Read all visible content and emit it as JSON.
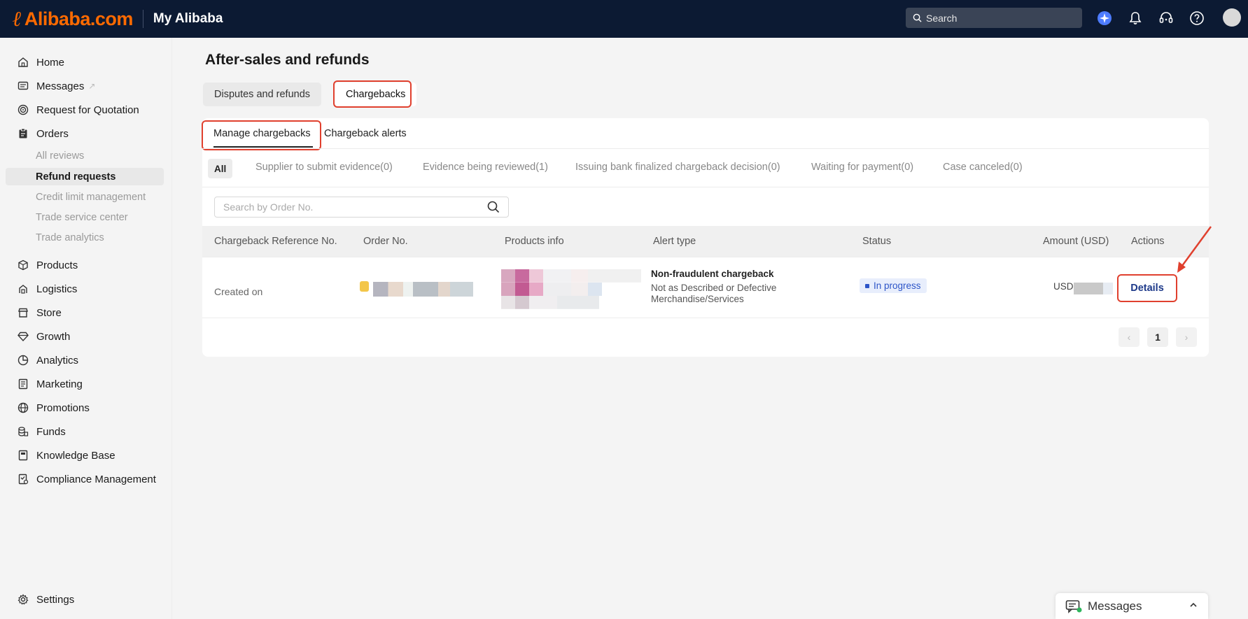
{
  "header": {
    "logo_text": "Alibaba.com",
    "brand_sub": "My Alibaba",
    "search_placeholder": "Search"
  },
  "sidebar": {
    "items": [
      {
        "label": "Home",
        "icon": "home-icon"
      },
      {
        "label": "Messages",
        "icon": "message-icon",
        "external": "↗"
      },
      {
        "label": "Request for Quotation",
        "icon": "target-icon"
      },
      {
        "label": "Orders",
        "icon": "clipboard-icon"
      },
      {
        "label": "Products",
        "icon": "cube-icon"
      },
      {
        "label": "Logistics",
        "icon": "truck-icon"
      },
      {
        "label": "Store",
        "icon": "store-icon"
      },
      {
        "label": "Growth",
        "icon": "diamond-icon"
      },
      {
        "label": "Analytics",
        "icon": "pie-icon"
      },
      {
        "label": "Marketing",
        "icon": "document-icon"
      },
      {
        "label": "Promotions",
        "icon": "globe-icon"
      },
      {
        "label": "Funds",
        "icon": "coins-icon"
      },
      {
        "label": "Knowledge Base",
        "icon": "book-icon"
      },
      {
        "label": "Compliance Management",
        "icon": "checklist-icon"
      }
    ],
    "orders_sub": [
      {
        "label": "All reviews"
      },
      {
        "label": "Refund requests"
      },
      {
        "label": "Credit limit management"
      },
      {
        "label": "Trade service center"
      },
      {
        "label": "Trade analytics"
      }
    ],
    "settings_label": "Settings"
  },
  "page": {
    "title": "After-sales and refunds",
    "tabs": [
      "Disputes and refunds",
      "Chargebacks"
    ],
    "sub_tabs": [
      "Manage chargebacks",
      "Chargeback alerts"
    ],
    "filters": [
      "All",
      "Supplier to submit evidence(0)",
      "Evidence being reviewed(1)",
      "Issuing bank finalized chargeback decision(0)",
      "Waiting for payment(0)",
      "Case canceled(0)"
    ],
    "order_search_placeholder": "Search by Order No."
  },
  "table": {
    "headers": [
      "Chargeback Reference No.",
      "Order No.",
      "Products info",
      "Alert type",
      "Status",
      "Amount (USD)",
      "Actions"
    ],
    "row": {
      "created_on": "Created on",
      "alert_title": "Non-fraudulent chargeback",
      "alert_desc": "Not as Described or Defective Merchandise/Services",
      "status": "In progress",
      "amount_prefix": "USD",
      "action": "Details"
    }
  },
  "pagination": {
    "prev": "‹",
    "current": "1",
    "next": "›"
  },
  "messages_panel": {
    "label": "Messages"
  },
  "colors": {
    "topbar": "#0c1a33",
    "brand_orange": "#ff6a00",
    "highlight_red": "#e0402e",
    "status_blue": "#2d55c8"
  }
}
